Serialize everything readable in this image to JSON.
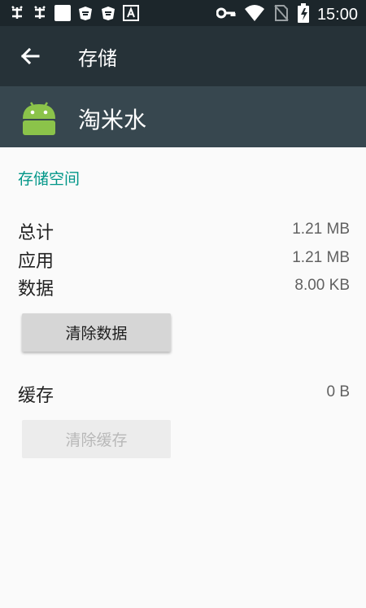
{
  "status_bar": {
    "time": "15:00",
    "left_icons": [
      "bug-icon",
      "bug-icon",
      "square-icon",
      "app-badge-icon",
      "app-badge-icon",
      "font-a-icon"
    ],
    "right_icons": [
      "key-icon",
      "wifi-icon",
      "no-sim-icon",
      "battery-charging-icon"
    ]
  },
  "toolbar": {
    "title": "存储"
  },
  "app": {
    "name": "淘米水",
    "icon": "android-icon"
  },
  "storage": {
    "section_title": "存储空间",
    "rows": [
      {
        "label": "总计",
        "value": "1.21 MB"
      },
      {
        "label": "应用",
        "value": "1.21 MB"
      },
      {
        "label": "数据",
        "value": "8.00 KB"
      }
    ],
    "clear_data_label": "清除数据"
  },
  "cache": {
    "label": "缓存",
    "value": "0 B",
    "clear_cache_label": "清除缓存"
  },
  "colors": {
    "status_bar": "#1c262b",
    "toolbar": "#263238",
    "app_header": "#37474f",
    "accent": "#009688",
    "android_green": "#8bc34a"
  }
}
